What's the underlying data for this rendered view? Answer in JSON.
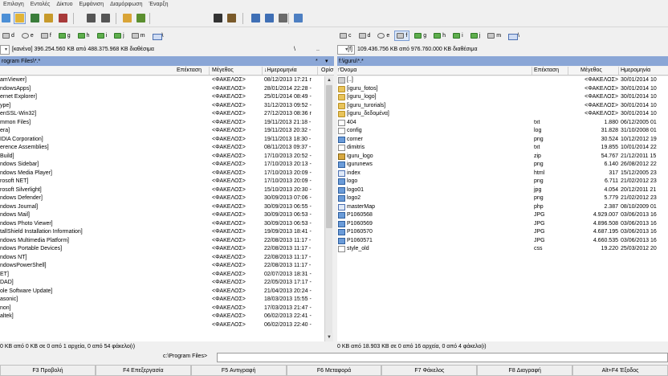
{
  "menu": [
    "Επιλογη",
    "Εντολές",
    "Δίκτυο",
    "Εμφάνιση",
    "Διαμόρφωση",
    "Έναρξη"
  ],
  "toolbar": {
    "buttons": [
      {
        "icon": "refresh-icon",
        "color": "#4c8fd6"
      },
      {
        "icon": "brief-view-icon",
        "color": "#e2b437",
        "active": true
      },
      {
        "icon": "full-view-icon",
        "color": "#3a7d3a"
      },
      {
        "icon": "tree-view-icon",
        "color": "#c79a2b"
      },
      {
        "icon": "invert-selection-icon",
        "color": "#a83a3a"
      },
      {
        "icon": "back-icon",
        "color": "#555555"
      },
      {
        "icon": "forward-icon",
        "color": "#555555"
      },
      {
        "icon": "pack-files-icon",
        "color": "#d9a437"
      },
      {
        "icon": "unpack-files-icon",
        "color": "#5b8f2f"
      },
      {
        "icon": "find-files-icon",
        "color": "#333333"
      },
      {
        "icon": "multi-rename-icon",
        "color": "#7a5a2a"
      },
      {
        "icon": "ftp-connect-icon",
        "color": "#3f6fb5"
      },
      {
        "icon": "ftp-new-connection-icon",
        "color": "#3f6fb5"
      },
      {
        "icon": "edit-icon",
        "color": "#6a6a6a"
      },
      {
        "icon": "notepad-icon",
        "color": "#4d7fc2"
      }
    ]
  },
  "left_drives": {
    "items": [
      {
        "label": "d",
        "kind": "disk"
      },
      {
        "label": "e",
        "kind": "cd"
      },
      {
        "label": "f",
        "kind": "disk"
      },
      {
        "label": "g",
        "kind": "net"
      },
      {
        "label": "h",
        "kind": "net"
      },
      {
        "label": "i",
        "kind": "net"
      },
      {
        "label": "j",
        "kind": "net"
      },
      {
        "label": "m",
        "kind": "disk"
      },
      {
        "label": "\\",
        "kind": "root"
      }
    ]
  },
  "right_drives": {
    "items": [
      {
        "label": "c",
        "kind": "disk"
      },
      {
        "label": "d",
        "kind": "disk"
      },
      {
        "label": "e",
        "kind": "cd"
      },
      {
        "label": "f",
        "kind": "disk",
        "active": true
      },
      {
        "label": "g",
        "kind": "net"
      },
      {
        "label": "h",
        "kind": "net"
      },
      {
        "label": "i",
        "kind": "net"
      },
      {
        "label": "j",
        "kind": "net"
      },
      {
        "label": "m",
        "kind": "disk"
      },
      {
        "label": "\\",
        "kind": "root"
      }
    ]
  },
  "left_pane": {
    "drive_select": "",
    "volume_info": "[κανένα]  396.254.560 KB από 488.375.968 KB διαθέσιμα",
    "root_btn": "\\",
    "up_btn": "..",
    "path": "rogram Files\\*.*",
    "path_star": "*",
    "path_arrow": "▾",
    "columns": {
      "ext": "Επέκταση",
      "size": "Μέγεθος",
      "date": "↓Ημερομηνία",
      "attr": "Ορίσ"
    },
    "rows": [
      {
        "name": "amViewer]",
        "size": "<ΦΑΚΕΛΟΣ>",
        "date": "08/12/2013 17:21 r"
      },
      {
        "name": "ndowsApps]",
        "size": "<ΦΑΚΕΛΟΣ>",
        "date": "28/01/2014 22:28 -"
      },
      {
        "name": "ernet Explorer]",
        "size": "<ΦΑΚΕΛΟΣ>",
        "date": "25/01/2014 08:49 -"
      },
      {
        "name": "ype]",
        "size": "<ΦΑΚΕΛΟΣ>",
        "date": "31/12/2013 09:52 -"
      },
      {
        "name": "enSSL-Win32]",
        "size": "<ΦΑΚΕΛΟΣ>",
        "date": "27/12/2013 08:36 r"
      },
      {
        "name": "mmon Files]",
        "size": "<ΦΑΚΕΛΟΣ>",
        "date": "19/11/2013 21:18 -"
      },
      {
        "name": "era]",
        "size": "<ΦΑΚΕΛΟΣ>",
        "date": "19/11/2013 20:32 -"
      },
      {
        "name": "IDIA Corporation]",
        "size": "<ΦΑΚΕΛΟΣ>",
        "date": "19/11/2013 18:30 -"
      },
      {
        "name": "erence Assemblies]",
        "size": "<ΦΑΚΕΛΟΣ>",
        "date": "08/11/2013 09:37 -"
      },
      {
        "name": "Build]",
        "size": "<ΦΑΚΕΛΟΣ>",
        "date": "17/10/2013 20:52 -"
      },
      {
        "name": "ndows Sidebar]",
        "size": "<ΦΑΚΕΛΟΣ>",
        "date": "17/10/2013 20:13 -"
      },
      {
        "name": "ndows Media Player]",
        "size": "<ΦΑΚΕΛΟΣ>",
        "date": "17/10/2013 20:09 -"
      },
      {
        "name": "rosoft NET]",
        "size": "<ΦΑΚΕΛΟΣ>",
        "date": "17/10/2013 20:09 -"
      },
      {
        "name": "rosoft Silverlight]",
        "size": "<ΦΑΚΕΛΟΣ>",
        "date": "15/10/2013 20:30 -"
      },
      {
        "name": "ndows Defender]",
        "size": "<ΦΑΚΕΛΟΣ>",
        "date": "30/09/2013 07:06 -"
      },
      {
        "name": "ndows Journal]",
        "size": "<ΦΑΚΕΛΟΣ>",
        "date": "30/09/2013 06:55 -"
      },
      {
        "name": "ndows Mail]",
        "size": "<ΦΑΚΕΛΟΣ>",
        "date": "30/09/2013 06:53 -"
      },
      {
        "name": "ndows Photo Viewer]",
        "size": "<ΦΑΚΕΛΟΣ>",
        "date": "30/09/2013 06:53 -"
      },
      {
        "name": "tallShield Installation Information]",
        "size": "<ΦΑΚΕΛΟΣ>",
        "date": "19/09/2013 18:41 -"
      },
      {
        "name": "ndows Multimedia Platform]",
        "size": "<ΦΑΚΕΛΟΣ>",
        "date": "22/08/2013 11:17 -"
      },
      {
        "name": "ndows Portable Devices]",
        "size": "<ΦΑΚΕΛΟΣ>",
        "date": "22/08/2013 11:17 -"
      },
      {
        "name": "ndows NT]",
        "size": "<ΦΑΚΕΛΟΣ>",
        "date": "22/08/2013 11:17 -"
      },
      {
        "name": "ndowsPowerShell]",
        "size": "<ΦΑΚΕΛΟΣ>",
        "date": "22/08/2013 11:17 -"
      },
      {
        "name": "ET]",
        "size": "<ΦΑΚΕΛΟΣ>",
        "date": "02/07/2013 18:31 -"
      },
      {
        "name": "DAD]",
        "size": "<ΦΑΚΕΛΟΣ>",
        "date": "22/05/2013 17:17 -"
      },
      {
        "name": "ole Software Update]",
        "size": "<ΦΑΚΕΛΟΣ>",
        "date": "21/04/2013 20:24 -"
      },
      {
        "name": "asonic]",
        "size": "<ΦΑΚΕΛΟΣ>",
        "date": "18/03/2013 15:55 -"
      },
      {
        "name": "non]",
        "size": "<ΦΑΚΕΛΟΣ>",
        "date": "17/03/2013 21:47 -"
      },
      {
        "name": "altek]",
        "size": "<ΦΑΚΕΛΟΣ>",
        "date": "06/02/2013 22:41 -"
      },
      {
        "name": "",
        "size": "<ΦΑΚΕΛΟΣ>",
        "date": "06/02/2013 22:40 -"
      }
    ],
    "status": "0 KB από 0 KB σε 0 από 1 αρχεία, 0 από 54 φάκελο(ι)"
  },
  "right_pane": {
    "drive_select": "[f]",
    "volume_info": "109.436.756 KB από 976.760.000 KB διαθέσιμα",
    "root_btn": "\\",
    "up_btn": "..",
    "path": "f:\\iguru\\*.*",
    "path_star": "*",
    "path_arrow": "▾",
    "columns": {
      "name": "↑Όνομα",
      "ext": "Επέκταση",
      "size": "Μέγεθος",
      "date": "Ημερομηνία"
    },
    "rows": [
      {
        "icon": "up",
        "name": "[..]",
        "ext": "",
        "size": "<ΦΑΚΕΛΟΣ>",
        "date": "30/01/2014 10"
      },
      {
        "icon": "folder",
        "name": "[iguru_fotos]",
        "ext": "",
        "size": "<ΦΑΚΕΛΟΣ>",
        "date": "30/01/2014 10"
      },
      {
        "icon": "folder",
        "name": "[iguru_logo]",
        "ext": "",
        "size": "<ΦΑΚΕΛΟΣ>",
        "date": "30/01/2014 10"
      },
      {
        "icon": "folder",
        "name": "[iguru_turorials]",
        "ext": "",
        "size": "<ΦΑΚΕΛΟΣ>",
        "date": "30/01/2014 10"
      },
      {
        "icon": "folder",
        "name": "[iguru_δεδομένα]",
        "ext": "",
        "size": "<ΦΑΚΕΛΟΣ>",
        "date": "30/01/2014 10"
      },
      {
        "icon": "doc",
        "name": "404",
        "ext": "txt",
        "size": "1.880",
        "date": "06/12/2005 01"
      },
      {
        "icon": "doc",
        "name": "config",
        "ext": "log",
        "size": "31.828",
        "date": "31/10/2008 01"
      },
      {
        "icon": "img",
        "name": "corner",
        "ext": "png",
        "size": "30.524",
        "date": "10/12/2012 19"
      },
      {
        "icon": "doc",
        "name": "dimitris",
        "ext": "txt",
        "size": "19.855",
        "date": "10/01/2014 22"
      },
      {
        "icon": "zip",
        "name": "iguru_logo",
        "ext": "zip",
        "size": "54.767",
        "date": "21/12/2011 15"
      },
      {
        "icon": "img",
        "name": "igurunews",
        "ext": "png",
        "size": "6.140",
        "date": "26/08/2012 22"
      },
      {
        "icon": "web",
        "name": "index",
        "ext": "html",
        "size": "317",
        "date": "15/12/2005 23"
      },
      {
        "icon": "img",
        "name": "logo",
        "ext": "png",
        "size": "6.711",
        "date": "21/02/2012 23"
      },
      {
        "icon": "img",
        "name": "logo01",
        "ext": "jpg",
        "size": "4.054",
        "date": "20/12/2011 21"
      },
      {
        "icon": "img",
        "name": "logo2",
        "ext": "png",
        "size": "5.779",
        "date": "21/02/2012 23"
      },
      {
        "icon": "web",
        "name": "masterMap",
        "ext": "php",
        "size": "2.387",
        "date": "08/10/2009 01"
      },
      {
        "icon": "img",
        "name": "P1060568",
        "ext": "JPG",
        "size": "4.929.007",
        "date": "03/06/2013 16"
      },
      {
        "icon": "img",
        "name": "P1060569",
        "ext": "JPG",
        "size": "4.896.508",
        "date": "03/06/2013 16"
      },
      {
        "icon": "img",
        "name": "P1060570",
        "ext": "JPG",
        "size": "4.687.195",
        "date": "03/06/2013 16"
      },
      {
        "icon": "img",
        "name": "P1060571",
        "ext": "JPG",
        "size": "4.660.535",
        "date": "03/06/2013 16"
      },
      {
        "icon": "doc",
        "name": "style_old",
        "ext": "css",
        "size": "19.220",
        "date": "25/03/2012 20"
      }
    ],
    "status": "0 KB από 18.903 KB σε 0 από 16 αρχεία, 0 από 4 φάκελο(ι)"
  },
  "command_line": {
    "prompt": "c:\\Program Files>",
    "value": ""
  },
  "fkeys": [
    "F3 Προβολή",
    "F4 Επεξεργασία",
    "F5 Αντιγραφή",
    "F6 Μεταφορά",
    "F7 Φάκελος",
    "F8 Διαγραφή",
    "Alt+F4 Έξοδος"
  ],
  "colors": {
    "path_active": "#8aa6d6",
    "selection": "#dbe7f8",
    "accent": "#7a9cd3"
  }
}
